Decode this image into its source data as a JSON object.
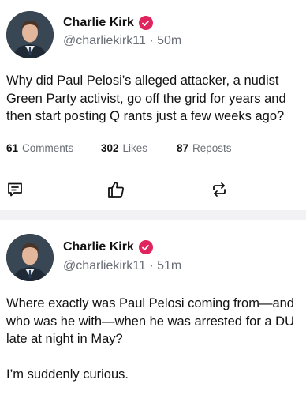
{
  "posts": [
    {
      "author": "Charlie Kirk",
      "handle": "@charliekirk11",
      "separator": "·",
      "time": "50m",
      "lines": [
        "Why did Paul Pelosi’s alleged attacker, a nudist",
        "Green Party activist, go off the grid for years and",
        "then start posting Q rants just a few weeks ago?"
      ],
      "comments_count": "61",
      "comments_label": "Comments",
      "likes_count": "302",
      "likes_label": "Likes",
      "reposts_count": "87",
      "reposts_label": "Reposts"
    },
    {
      "author": "Charlie Kirk",
      "handle": "@charliekirk11",
      "separator": "·",
      "time": "51m",
      "lines": [
        "Where exactly was Paul Pelosi coming from—and",
        "who was he with—when he was arrested for a DU",
        "late at night in May?",
        "",
        "I’m suddenly curious."
      ]
    }
  ],
  "icons": {
    "verified": "verified-badge-icon",
    "comment": "comment-icon",
    "like": "thumbs-up-icon",
    "repost": "repost-icon"
  },
  "colors": {
    "badge": "#e0245e",
    "muted": "#6b6f76",
    "divider": "#f2f2f4"
  }
}
